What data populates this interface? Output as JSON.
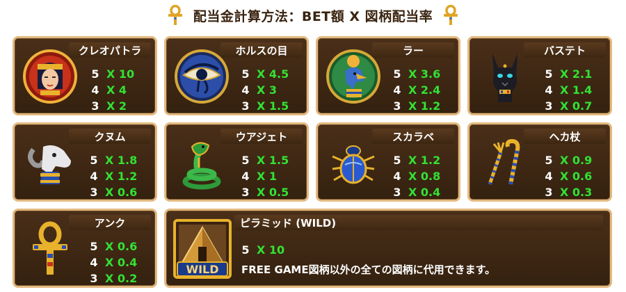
{
  "header": {
    "title": "配当金計算方法：BET額 X 図柄配当率"
  },
  "symbols": [
    {
      "name": "クレオパトラ",
      "icon": "cleopatra-icon",
      "pays": [
        {
          "count": "5",
          "mult": "X 10"
        },
        {
          "count": "4",
          "mult": "X 4"
        },
        {
          "count": "3",
          "mult": "X 2"
        }
      ]
    },
    {
      "name": "ホルスの目",
      "icon": "eye-of-horus-icon",
      "pays": [
        {
          "count": "5",
          "mult": "X 4.5"
        },
        {
          "count": "4",
          "mult": "X 3"
        },
        {
          "count": "3",
          "mult": "X 1.5"
        }
      ]
    },
    {
      "name": "ラー",
      "icon": "ra-icon",
      "pays": [
        {
          "count": "5",
          "mult": "X 3.6"
        },
        {
          "count": "4",
          "mult": "X 2.4"
        },
        {
          "count": "3",
          "mult": "X 1.2"
        }
      ]
    },
    {
      "name": "バステト",
      "icon": "bastet-cat-icon",
      "pays": [
        {
          "count": "5",
          "mult": "X 2.1"
        },
        {
          "count": "4",
          "mult": "X 1.4"
        },
        {
          "count": "3",
          "mult": "X 0.7"
        }
      ]
    },
    {
      "name": "クヌム",
      "icon": "khnum-ram-icon",
      "pays": [
        {
          "count": "5",
          "mult": "X 1.8"
        },
        {
          "count": "4",
          "mult": "X 1.2"
        },
        {
          "count": "3",
          "mult": "X 0.6"
        }
      ]
    },
    {
      "name": "ウアジェト",
      "icon": "wadjet-cobra-icon",
      "pays": [
        {
          "count": "5",
          "mult": "X 1.5"
        },
        {
          "count": "4",
          "mult": "X 1"
        },
        {
          "count": "3",
          "mult": "X 0.5"
        }
      ]
    },
    {
      "name": "スカラベ",
      "icon": "scarab-icon",
      "pays": [
        {
          "count": "5",
          "mult": "X 1.2"
        },
        {
          "count": "4",
          "mult": "X 0.8"
        },
        {
          "count": "3",
          "mult": "X 0.4"
        }
      ]
    },
    {
      "name": "ヘカ杖",
      "icon": "crook-and-flail-icon",
      "pays": [
        {
          "count": "5",
          "mult": "X 0.9"
        },
        {
          "count": "4",
          "mult": "X 0.6"
        },
        {
          "count": "3",
          "mult": "X 0.3"
        }
      ]
    },
    {
      "name": "アンク",
      "icon": "ankh-icon",
      "pays": [
        {
          "count": "5",
          "mult": "X 0.6"
        },
        {
          "count": "4",
          "mult": "X 0.4"
        },
        {
          "count": "3",
          "mult": "X 0.2"
        }
      ]
    }
  ],
  "wild": {
    "name": "ピラミッド (WILD)",
    "icon": "pyramid-wild-icon",
    "badge": "WILD",
    "pay": {
      "count": "5",
      "mult": "X 10"
    },
    "description": "FREE GAME図柄以外の全ての図柄に代用できます。"
  },
  "colors": {
    "panel_bg": "#3d2712",
    "panel_border": "#e3b980",
    "multiplier": "#33e233",
    "text": "#ffffff"
  }
}
